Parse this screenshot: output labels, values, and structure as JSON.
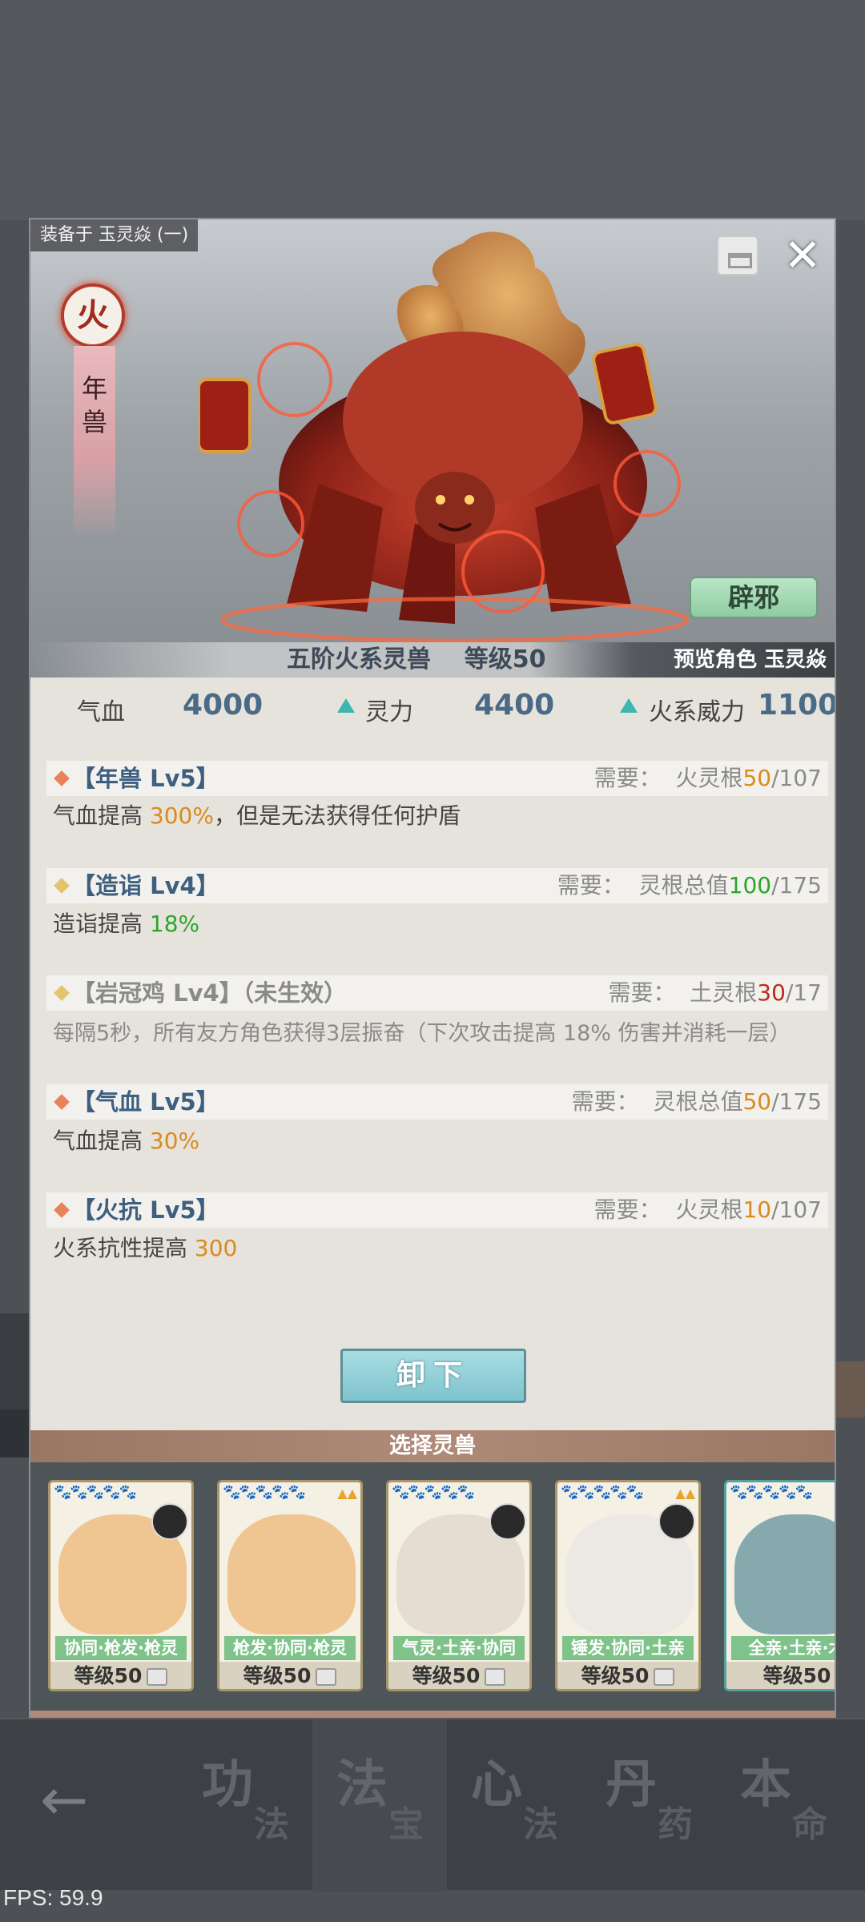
{
  "modal": {
    "equipped_on": "装备于 玉灵焱 (一)",
    "element": "火",
    "beast_name": "年兽",
    "bixie_label": "辟邪",
    "tier_text": "五阶火系灵兽    等级50",
    "preview_text": "预览角色 玉灵焱",
    "close_icon": "close-icon",
    "bag_icon": "bag-icon"
  },
  "stats": {
    "hp_label": "气血",
    "hp_value": "4000",
    "spirit_label": "灵力",
    "spirit_value": "4400",
    "fire_label": "火系威力",
    "fire_value": "1100"
  },
  "skills": [
    {
      "title": "【年兽 Lv5】",
      "req_prefix": "需要：  火灵根",
      "req_have": "50",
      "req_total": "/107",
      "desc_a": "气血提高 ",
      "desc_hl": "300%",
      "desc_b": "，但是无法获得任何护盾",
      "diamond_color": "#e8825a"
    },
    {
      "title": "【造诣 Lv4】",
      "req_prefix": "需要：  灵根总值",
      "req_have": "100",
      "req_total": "/175",
      "desc_a": "造诣提高 ",
      "desc_hl": "18%",
      "desc_b": "",
      "diamond_color": "#e2c46a"
    },
    {
      "title": "【岩冠鸡 Lv4】（未生效）",
      "req_prefix": "需要：  土灵根",
      "req_have": "30",
      "req_total": "/17",
      "desc_a": "每隔5秒，所有友方角色获得3层振奋（下次攻击提高 18% 伤害并消耗一层）",
      "desc_hl": "",
      "desc_b": "",
      "diamond_color": "#e2c46a"
    },
    {
      "title": "【气血 Lv5】",
      "req_prefix": "需要：  灵根总值",
      "req_have": "50",
      "req_total": "/175",
      "desc_a": "气血提高 ",
      "desc_hl": "30%",
      "desc_b": "",
      "diamond_color": "#e8825a"
    },
    {
      "title": "【火抗 Lv5】",
      "req_prefix": "需要：  火灵根",
      "req_have": "10",
      "req_total": "/107",
      "desc_a": "火系抗性提高 ",
      "desc_hl": "300",
      "desc_b": "",
      "diamond_color": "#e8825a"
    }
  ],
  "unequip_label": "卸下",
  "select_title": "选择灵兽",
  "cards": [
    {
      "tags": "协同·枪发·枪灵",
      "level": "等级50",
      "body_color": "#efc592"
    },
    {
      "tags": "枪发·协同·枪灵",
      "level": "等级50",
      "body_color": "#efc592"
    },
    {
      "tags": "气灵·土亲·协同",
      "level": "等级50",
      "body_color": "#e6ddd2"
    },
    {
      "tags": "锤发·协同·土亲",
      "level": "等级50",
      "body_color": "#ece9e4"
    },
    {
      "tags": "全亲·土亲·木",
      "level": "等级50",
      "body_color": "#86a9ae"
    }
  ],
  "nav": {
    "back_icon": "back-arrow-icon",
    "items": [
      {
        "big": "功",
        "small": "法"
      },
      {
        "big": "法",
        "small": "宝"
      },
      {
        "big": "心",
        "small": "法"
      },
      {
        "big": "丹",
        "small": "药"
      },
      {
        "big": "本",
        "small": "命"
      }
    ]
  },
  "fps": "FPS: 59.9"
}
